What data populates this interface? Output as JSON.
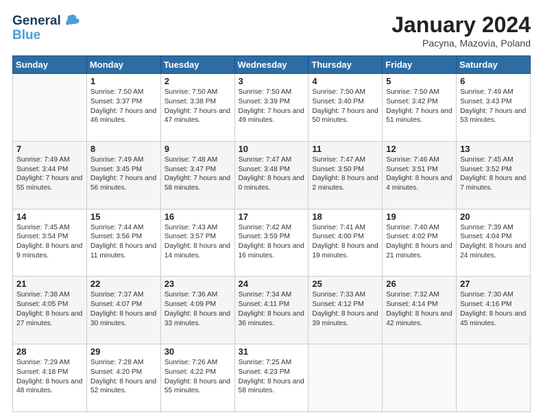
{
  "header": {
    "logo_line1": "General",
    "logo_line2": "Blue",
    "month_title": "January 2024",
    "location": "Pacyna, Mazovia, Poland"
  },
  "days_of_week": [
    "Sunday",
    "Monday",
    "Tuesday",
    "Wednesday",
    "Thursday",
    "Friday",
    "Saturday"
  ],
  "weeks": [
    [
      {
        "day": "",
        "sunrise": "",
        "sunset": "",
        "daylight": ""
      },
      {
        "day": "1",
        "sunrise": "Sunrise: 7:50 AM",
        "sunset": "Sunset: 3:37 PM",
        "daylight": "Daylight: 7 hours and 46 minutes."
      },
      {
        "day": "2",
        "sunrise": "Sunrise: 7:50 AM",
        "sunset": "Sunset: 3:38 PM",
        "daylight": "Daylight: 7 hours and 47 minutes."
      },
      {
        "day": "3",
        "sunrise": "Sunrise: 7:50 AM",
        "sunset": "Sunset: 3:39 PM",
        "daylight": "Daylight: 7 hours and 49 minutes."
      },
      {
        "day": "4",
        "sunrise": "Sunrise: 7:50 AM",
        "sunset": "Sunset: 3:40 PM",
        "daylight": "Daylight: 7 hours and 50 minutes."
      },
      {
        "day": "5",
        "sunrise": "Sunrise: 7:50 AM",
        "sunset": "Sunset: 3:42 PM",
        "daylight": "Daylight: 7 hours and 51 minutes."
      },
      {
        "day": "6",
        "sunrise": "Sunrise: 7:49 AM",
        "sunset": "Sunset: 3:43 PM",
        "daylight": "Daylight: 7 hours and 53 minutes."
      }
    ],
    [
      {
        "day": "7",
        "sunrise": "Sunrise: 7:49 AM",
        "sunset": "Sunset: 3:44 PM",
        "daylight": "Daylight: 7 hours and 55 minutes."
      },
      {
        "day": "8",
        "sunrise": "Sunrise: 7:49 AM",
        "sunset": "Sunset: 3:45 PM",
        "daylight": "Daylight: 7 hours and 56 minutes."
      },
      {
        "day": "9",
        "sunrise": "Sunrise: 7:48 AM",
        "sunset": "Sunset: 3:47 PM",
        "daylight": "Daylight: 7 hours and 58 minutes."
      },
      {
        "day": "10",
        "sunrise": "Sunrise: 7:47 AM",
        "sunset": "Sunset: 3:48 PM",
        "daylight": "Daylight: 8 hours and 0 minutes."
      },
      {
        "day": "11",
        "sunrise": "Sunrise: 7:47 AM",
        "sunset": "Sunset: 3:50 PM",
        "daylight": "Daylight: 8 hours and 2 minutes."
      },
      {
        "day": "12",
        "sunrise": "Sunrise: 7:46 AM",
        "sunset": "Sunset: 3:51 PM",
        "daylight": "Daylight: 8 hours and 4 minutes."
      },
      {
        "day": "13",
        "sunrise": "Sunrise: 7:45 AM",
        "sunset": "Sunset: 3:52 PM",
        "daylight": "Daylight: 8 hours and 7 minutes."
      }
    ],
    [
      {
        "day": "14",
        "sunrise": "Sunrise: 7:45 AM",
        "sunset": "Sunset: 3:54 PM",
        "daylight": "Daylight: 8 hours and 9 minutes."
      },
      {
        "day": "15",
        "sunrise": "Sunrise: 7:44 AM",
        "sunset": "Sunset: 3:56 PM",
        "daylight": "Daylight: 8 hours and 11 minutes."
      },
      {
        "day": "16",
        "sunrise": "Sunrise: 7:43 AM",
        "sunset": "Sunset: 3:57 PM",
        "daylight": "Daylight: 8 hours and 14 minutes."
      },
      {
        "day": "17",
        "sunrise": "Sunrise: 7:42 AM",
        "sunset": "Sunset: 3:59 PM",
        "daylight": "Daylight: 8 hours and 16 minutes."
      },
      {
        "day": "18",
        "sunrise": "Sunrise: 7:41 AM",
        "sunset": "Sunset: 4:00 PM",
        "daylight": "Daylight: 8 hours and 19 minutes."
      },
      {
        "day": "19",
        "sunrise": "Sunrise: 7:40 AM",
        "sunset": "Sunset: 4:02 PM",
        "daylight": "Daylight: 8 hours and 21 minutes."
      },
      {
        "day": "20",
        "sunrise": "Sunrise: 7:39 AM",
        "sunset": "Sunset: 4:04 PM",
        "daylight": "Daylight: 8 hours and 24 minutes."
      }
    ],
    [
      {
        "day": "21",
        "sunrise": "Sunrise: 7:38 AM",
        "sunset": "Sunset: 4:05 PM",
        "daylight": "Daylight: 8 hours and 27 minutes."
      },
      {
        "day": "22",
        "sunrise": "Sunrise: 7:37 AM",
        "sunset": "Sunset: 4:07 PM",
        "daylight": "Daylight: 8 hours and 30 minutes."
      },
      {
        "day": "23",
        "sunrise": "Sunrise: 7:36 AM",
        "sunset": "Sunset: 4:09 PM",
        "daylight": "Daylight: 8 hours and 33 minutes."
      },
      {
        "day": "24",
        "sunrise": "Sunrise: 7:34 AM",
        "sunset": "Sunset: 4:11 PM",
        "daylight": "Daylight: 8 hours and 36 minutes."
      },
      {
        "day": "25",
        "sunrise": "Sunrise: 7:33 AM",
        "sunset": "Sunset: 4:12 PM",
        "daylight": "Daylight: 8 hours and 39 minutes."
      },
      {
        "day": "26",
        "sunrise": "Sunrise: 7:32 AM",
        "sunset": "Sunset: 4:14 PM",
        "daylight": "Daylight: 8 hours and 42 minutes."
      },
      {
        "day": "27",
        "sunrise": "Sunrise: 7:30 AM",
        "sunset": "Sunset: 4:16 PM",
        "daylight": "Daylight: 8 hours and 45 minutes."
      }
    ],
    [
      {
        "day": "28",
        "sunrise": "Sunrise: 7:29 AM",
        "sunset": "Sunset: 4:18 PM",
        "daylight": "Daylight: 8 hours and 48 minutes."
      },
      {
        "day": "29",
        "sunrise": "Sunrise: 7:28 AM",
        "sunset": "Sunset: 4:20 PM",
        "daylight": "Daylight: 8 hours and 52 minutes."
      },
      {
        "day": "30",
        "sunrise": "Sunrise: 7:26 AM",
        "sunset": "Sunset: 4:22 PM",
        "daylight": "Daylight: 8 hours and 55 minutes."
      },
      {
        "day": "31",
        "sunrise": "Sunrise: 7:25 AM",
        "sunset": "Sunset: 4:23 PM",
        "daylight": "Daylight: 8 hours and 58 minutes."
      },
      {
        "day": "",
        "sunrise": "",
        "sunset": "",
        "daylight": ""
      },
      {
        "day": "",
        "sunrise": "",
        "sunset": "",
        "daylight": ""
      },
      {
        "day": "",
        "sunrise": "",
        "sunset": "",
        "daylight": ""
      }
    ]
  ]
}
